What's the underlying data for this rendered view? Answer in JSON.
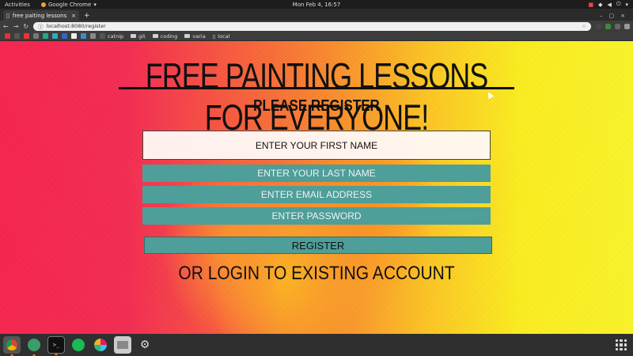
{
  "topbar": {
    "activities": "Activities",
    "app_name": "Google Chrome",
    "clock": "Mon Feb  4, 16:57"
  },
  "browser": {
    "tab_title": "free paiting lessons fo",
    "url": "localhost:8080/register",
    "bookmarks": [
      "catnip",
      "git",
      "coding",
      "varia",
      "local"
    ]
  },
  "page": {
    "heading": "FREE PAINTING LESSONS FOR EVERYONE!",
    "subheading": "PLEASE REGISTER",
    "first_name_placeholder": "ENTER YOUR FIRST NAME",
    "last_name_placeholder": "ENTER YOUR LAST NAME",
    "email_placeholder": "ENTER EMAIL ADDRESS",
    "password_placeholder": "ENTER PASSWORD",
    "register_label": "REGISTER",
    "login_link": "OR LOGIN TO EXISTING ACCOUNT"
  },
  "colors": {
    "field_teal": "#4e9e99",
    "bg_left": "#f8234f",
    "bg_right": "#fbf528"
  }
}
